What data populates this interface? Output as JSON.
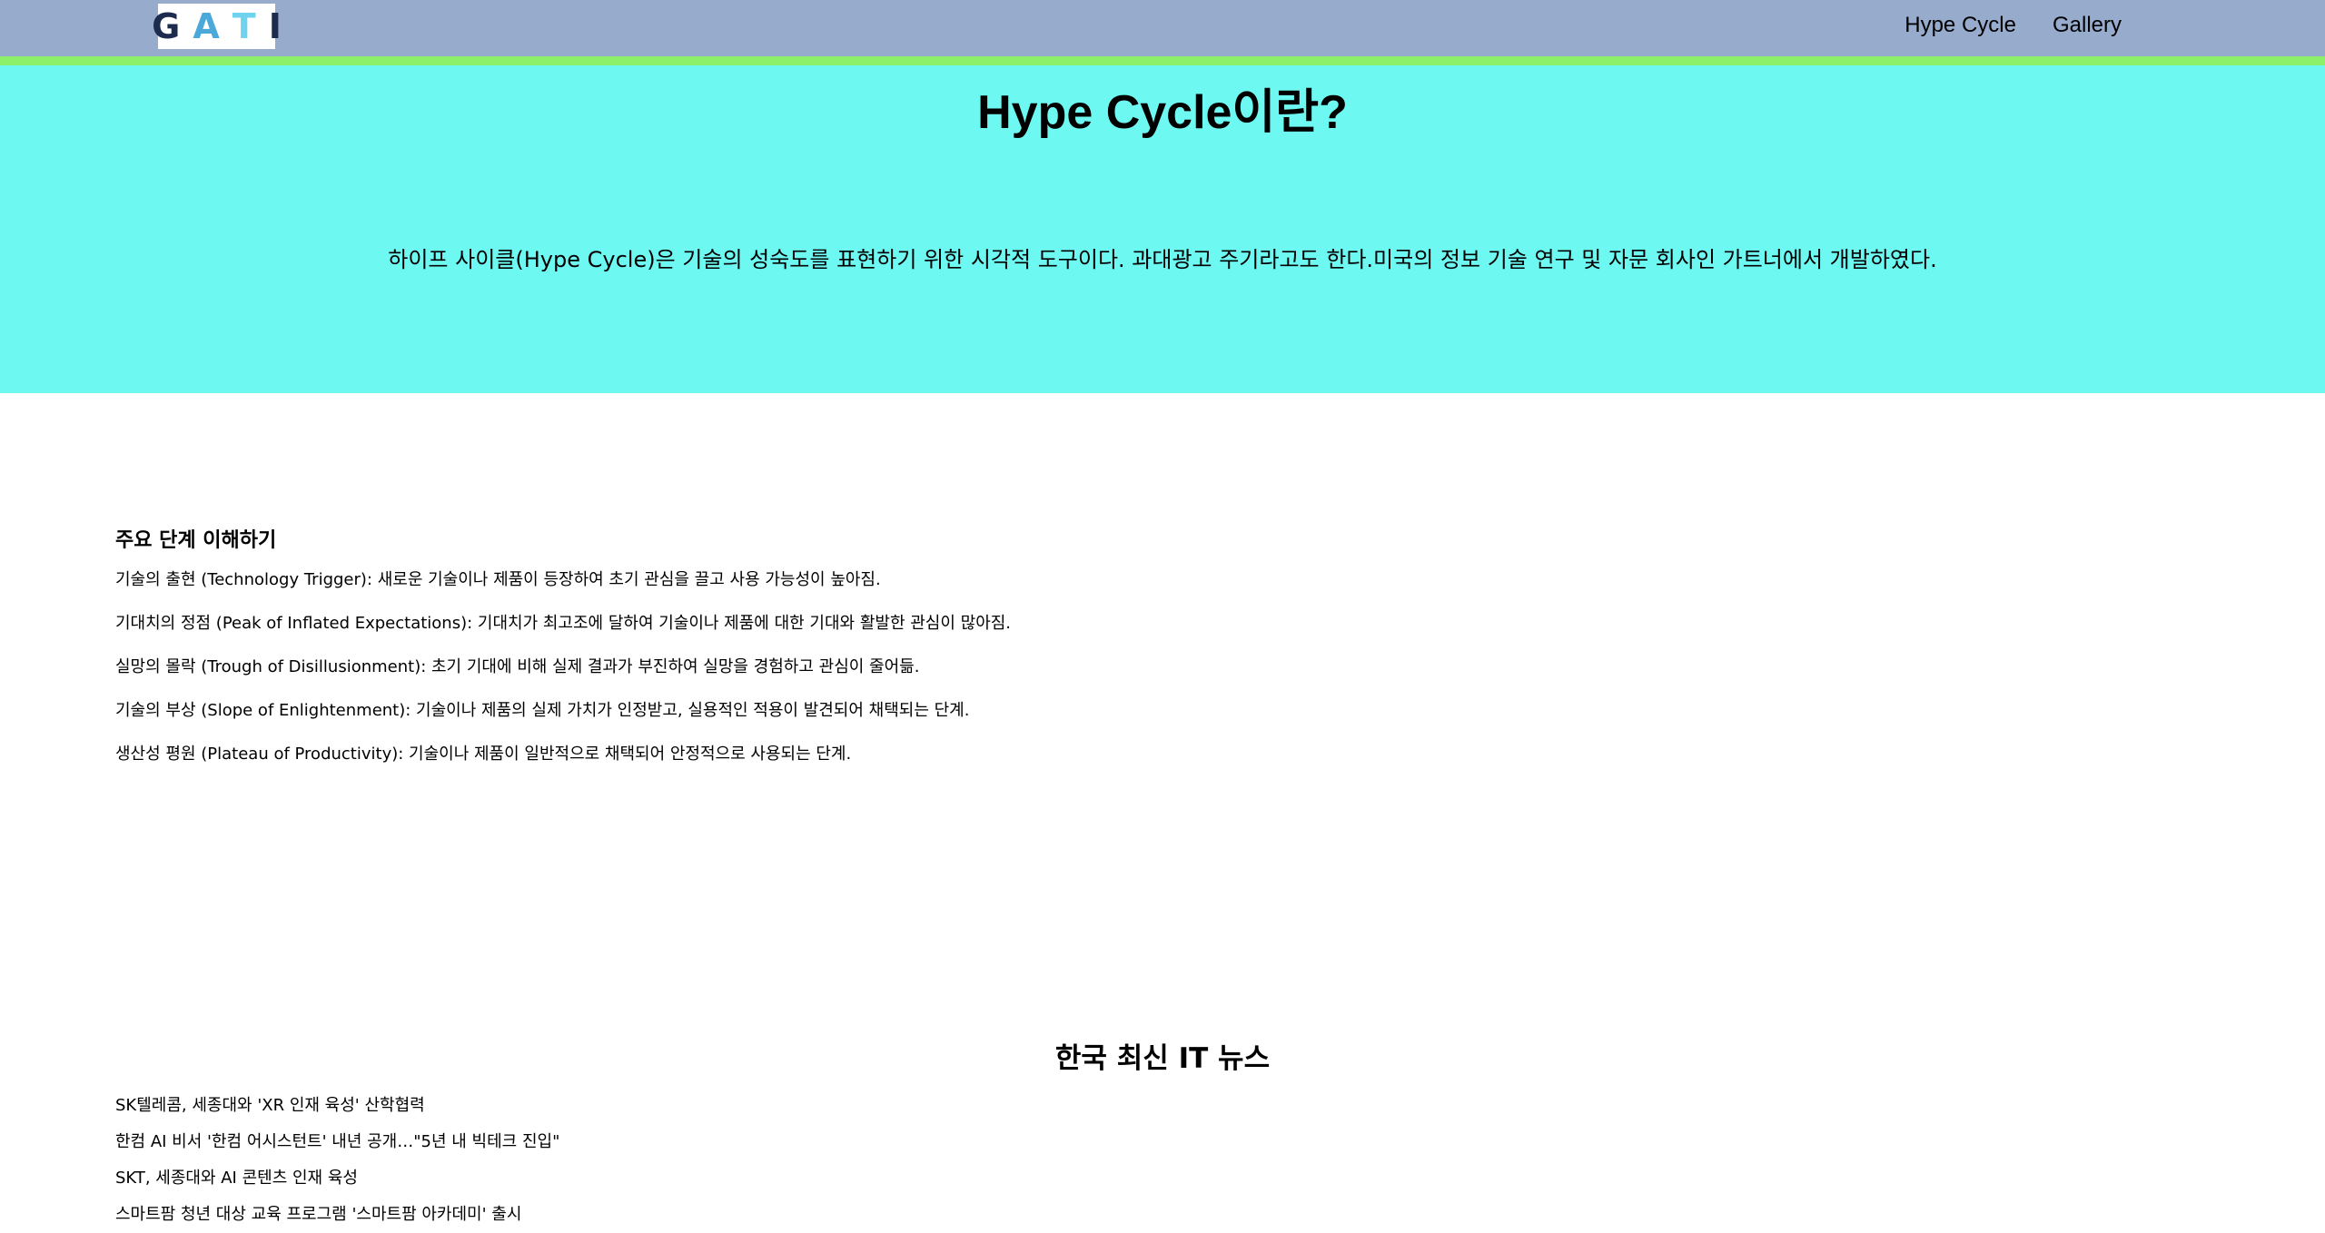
{
  "header": {
    "logo_letters": [
      {
        "char": "G",
        "color": "#1d2b4f"
      },
      {
        "char": "A",
        "color": "#4aa9d8"
      },
      {
        "char": "T",
        "color": "#6dd3ee"
      },
      {
        "char": "I",
        "color": "#1d2b4f"
      }
    ],
    "nav": [
      {
        "label": "Hype Cycle"
      },
      {
        "label": "Gallery"
      }
    ],
    "background_color": "#97abcd",
    "accent_color": "#8cf06a"
  },
  "hero": {
    "title": "Hype Cycle이란?",
    "description": "하이프 사이클(Hype Cycle)은 기술의 성숙도를 표현하기 위한 시각적 도구이다. 과대광고 주기라고도 한다.미국의 정보 기술 연구 및 자문 회사인 가트너에서 개발하였다.",
    "background_color": "#6ef8f2"
  },
  "stages": {
    "heading": "주요 단계 이해하기",
    "items": [
      "기술의 출현 (Technology Trigger): 새로운 기술이나 제품이 등장하여 초기 관심을 끌고 사용 가능성이 높아짐.",
      "기대치의 정점 (Peak of Inflated Expectations): 기대치가 최고조에 달하여 기술이나 제품에 대한 기대와 활발한 관심이 많아짐.",
      "실망의 몰락 (Trough of Disillusionment): 초기 기대에 비해 실제 결과가 부진하여 실망을 경험하고 관심이 줄어듦.",
      "기술의 부상 (Slope of Enlightenment): 기술이나 제품의 실제 가치가 인정받고, 실용적인 적용이 발견되어 채택되는 단계.",
      "생산성 평원 (Plateau of Productivity): 기술이나 제품이 일반적으로 채택되어 안정적으로 사용되는 단계."
    ]
  },
  "news": {
    "title": "한국 최신 IT 뉴스",
    "items": [
      "SK텔레콤, 세종대와 'XR 인재 육성' 산학협력",
      "한컴 AI 비서 '한컴 어시스턴트' 내년 공개…\"5년 내 빅테크 진입\"",
      "SKT, 세종대와 AI 콘텐츠 인재 육성",
      "스마트팜 청년 대상 교육 프로그램 '스마트팜 아카데미' 출시"
    ]
  }
}
